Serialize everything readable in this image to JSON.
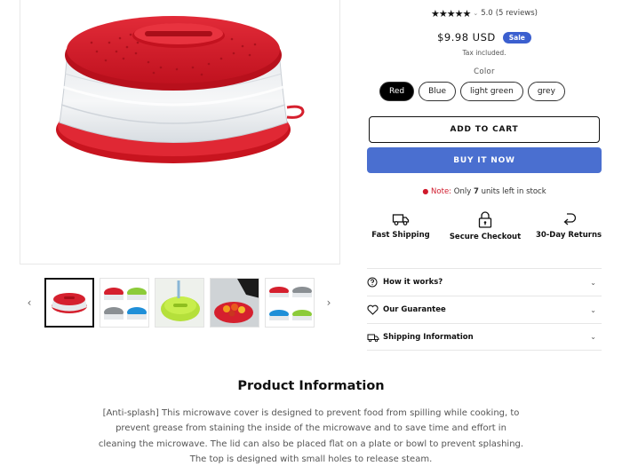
{
  "gallery": {
    "prev_icon": "chevron-left-icon",
    "next_icon": "chevron-right-icon",
    "thumbnail_count": 5
  },
  "product": {
    "rating": {
      "stars": "★★★★★",
      "value": "5.0",
      "reviews": "(5 reviews)"
    },
    "price": "$9.98 USD",
    "sale_badge": "Sale",
    "tax_note": "Tax included.",
    "color_label": "Color",
    "colors": [
      "Red",
      "Blue",
      "light green",
      "grey"
    ],
    "selected_color": "Red",
    "add_to_cart": "ADD TO CART",
    "buy_now": "BUY IT NOW",
    "stock": {
      "note_label": "Note:",
      "prefix": "Only",
      "count": "7",
      "suffix": "units left in stock"
    }
  },
  "features": [
    {
      "icon": "truck-icon",
      "label": "Fast Shipping"
    },
    {
      "icon": "lock-icon",
      "label": "Secure Checkout"
    },
    {
      "icon": "return-arrow-icon",
      "label": "30-Day Returns"
    }
  ],
  "accordions": [
    {
      "icon": "question-circle-icon",
      "title": "How it works?"
    },
    {
      "icon": "heart-icon",
      "title": "Our Guarantee"
    },
    {
      "icon": "truck-icon",
      "title": "Shipping Information"
    }
  ],
  "info": {
    "title": "Product Information",
    "description": "[Anti-splash] This microwave cover is designed to prevent food from spilling while cooking, to prevent grease from staining the inside of the microwave and to save time and effort in cleaning the microwave. The lid can also be placed flat on a plate or bowl to prevent splashing. The top is designed with small holes to release steam."
  },
  "colors": {
    "accent_blue": "#4a6fd0",
    "sale_blue": "#3b5fcf",
    "note_red": "#d0192b",
    "product_red": "#d5202e"
  }
}
